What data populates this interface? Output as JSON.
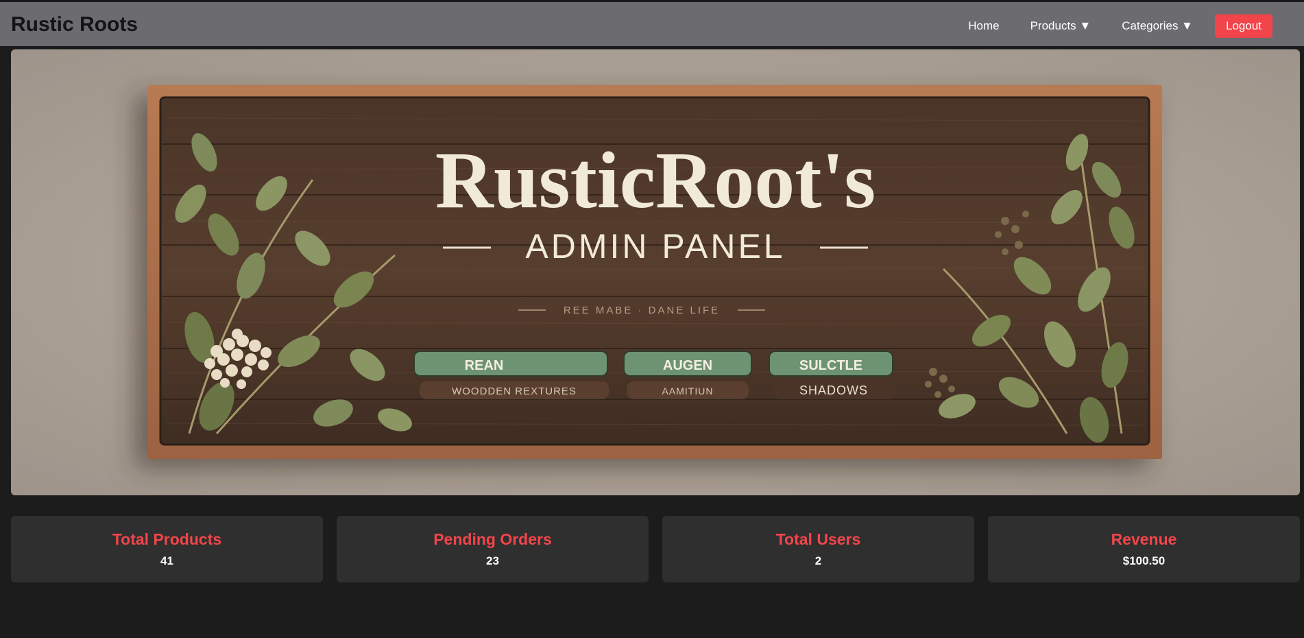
{
  "header": {
    "brand": "Rustic Roots",
    "nav": {
      "home": "Home",
      "products": "Products ▼",
      "categories": "Categories ▼",
      "logout": "Logout"
    }
  },
  "banner": {
    "title": "RusticRoot's",
    "subtitle": "ADMIN PANEL",
    "tagline": "REE MABE · DANE LIFE",
    "tags": [
      {
        "label": "REAN",
        "sub": "WOODDEN REXTURES"
      },
      {
        "label": "AUGEN",
        "sub": "AAMITIUN"
      },
      {
        "label": "SULCTLE",
        "sub": "SHADOWS"
      }
    ]
  },
  "stats": [
    {
      "title": "Total Products",
      "value": "41"
    },
    {
      "title": "Pending Orders",
      "value": "23"
    },
    {
      "title": "Total Users",
      "value": "2"
    },
    {
      "title": "Revenue",
      "value": "$100.50"
    }
  ],
  "colors": {
    "accent": "#f2454b",
    "header_bg": "#6c6b70",
    "page_bg": "#1c1c1c",
    "card_bg": "#2f2f2f"
  }
}
